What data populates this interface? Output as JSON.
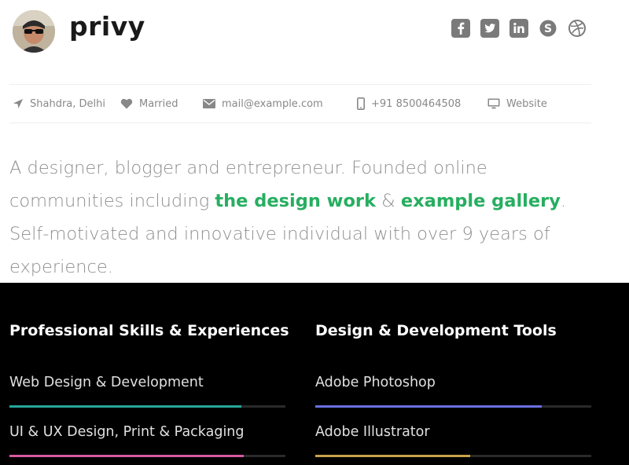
{
  "profile": {
    "name": "privy",
    "avatar_alt": "avatar"
  },
  "social": [
    {
      "name": "facebook-icon"
    },
    {
      "name": "twitter-icon"
    },
    {
      "name": "linkedin-icon"
    },
    {
      "name": "skype-icon"
    },
    {
      "name": "dribbble-icon"
    }
  ],
  "info": {
    "location": "Shahdra, Delhi",
    "status": "Married",
    "email": "mail@example.com",
    "phone": "+91 8500464508",
    "website": "Website"
  },
  "bio": {
    "part1": "A designer, blogger and entrepreneur. Founded online communities including ",
    "link1": "the design work",
    "part2": " & ",
    "link2": "example gallery",
    "part3": ". Self-motivated and innovative individual with over 9 years of experience."
  },
  "skills": {
    "left": {
      "title": "Professional Skills & Experiences",
      "items": [
        {
          "label": "Web Design & Development",
          "level": 0.84,
          "color": "#26a69a"
        },
        {
          "label": "UI & UX Design, Print & Packaging",
          "level": 0.85,
          "color": "#d65aa0"
        }
      ]
    },
    "right": {
      "title": "Design & Development Tools",
      "items": [
        {
          "label": "Adobe Photoshop",
          "level": 0.82,
          "color": "#6a6fe0"
        },
        {
          "label": "Adobe Illustrator",
          "level": 0.56,
          "color": "#c9a24a"
        }
      ]
    }
  },
  "colors": {
    "accent": "#27ae60",
    "dark": "#000000"
  }
}
